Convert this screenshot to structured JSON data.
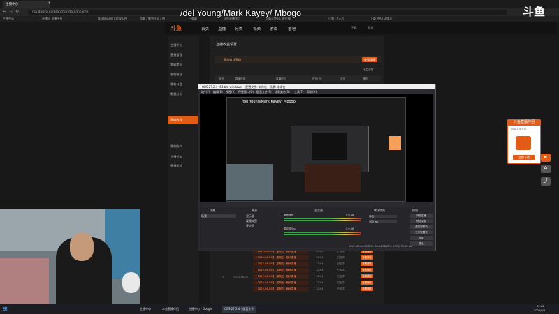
{
  "browser": {
    "tabs": [
      {
        "label": "主播中心"
      },
      {
        "label": "+"
      }
    ],
    "url": "mp.douyu.com/anchor/data/income",
    "bookmarks": [
      "主播中心",
      "直播间 直播平台",
      "Dashboard | ChatGPT",
      "你要了解到什么 | AI",
      "已收藏",
      "斗鱼直播伴侣",
      "下载斗鱼 PC 客户端",
      "已知 | 7天后",
      "下载 MAX 3 版本"
    ]
  },
  "stream_title": "/del Young/Mark Kayey/ Mbogo",
  "corner_logo": "斗鱼",
  "site": {
    "logo": "斗鱼",
    "nav": [
      "首页",
      "直播",
      "分类",
      "视频",
      "游戏",
      "鱼吧"
    ],
    "nav_right": [
      "下载",
      "登录"
    ],
    "sidebar": [
      {
        "label": "主播中心",
        "active": false
      },
      {
        "label": "直播管理",
        "active": false
      },
      {
        "label": "我的房间",
        "active": false
      },
      {
        "label": "我的粉丝",
        "active": false
      },
      {
        "label": "我的公会",
        "active": false
      },
      {
        "label": "数据分析",
        "active": false
      },
      {
        "label": "我的收益",
        "active": true
      },
      {
        "label": "我的账户",
        "active": false
      },
      {
        "label": "主播任务",
        "active": false
      },
      {
        "label": "直播学院",
        "active": false
      }
    ],
    "section_title": "直播收益设置",
    "notice": "我的收益等级",
    "notice_btn": "查看详情",
    "link_text": "收益说明",
    "table_headers": [
      "序号",
      "直播时间",
      "直播时长",
      "时长(分)",
      "状态",
      "操作"
    ],
    "rows": [
      {
        "title": "【 2022-08-05 】 星期五 · 晚间直播",
        "dur": "12:04",
        "status": "已结算",
        "btn": "查看详情"
      },
      {
        "title": "【 2022-08-05 】 星期五 · 晚间直播",
        "dur": "12:04",
        "status": "已结算",
        "btn": "查看详情"
      },
      {
        "title": "【 2022-08-05 】 星期五 · 晚间直播",
        "dur": "12:04",
        "status": "已结算",
        "btn": "查看详情"
      },
      {
        "title": "【 2022-08-05 】 星期五 · 晚间直播",
        "dur": "12:04",
        "status": "已结算",
        "btn": "查看详情"
      },
      {
        "title": "【 2022-08-05 】 星期五 · 晚间直播",
        "dur": "12:04",
        "status": "已结算",
        "btn": "查看详情"
      },
      {
        "title": "【 2022-08-05 】 星期五 · 晚间直播",
        "dur": "12:04",
        "status": "已结算",
        "btn": "查看详情"
      },
      {
        "title": "【 2022-08-05 】 星期五 · 晚间直播",
        "dur": "12:04",
        "status": "已结算",
        "btn": "查看详情"
      }
    ],
    "row_index": "1",
    "row_date": "2022-08-06"
  },
  "obs": {
    "title": "OBS 27.2.4 (64-bit, windows) - 配置文件: 未命名 - 场景: 未命名",
    "menu": [
      "文件(F)",
      "编辑(E)",
      "视图(V)",
      "停靠窗口(D)",
      "配置文件(P)",
      "场景集合(S)",
      "工具(T)",
      "帮助(H)"
    ],
    "preview_text": "/del Young/Mark Kayey/ Mbogo",
    "docks": [
      "场景",
      "来源",
      "混音器",
      "转场特效",
      "控制"
    ],
    "scene": "场景",
    "sources": [
      "显示器",
      "视频捕获",
      "麦克风"
    ],
    "mixer": [
      {
        "name": "桌面音频",
        "level": "0.0 dB"
      },
      {
        "name": "麦克风/Aux",
        "level": "0.0 dB"
      }
    ],
    "transition": "淡出",
    "transition_ms": "300 ms",
    "controls": [
      "开始直播",
      "停止录制",
      "虚拟摄像机",
      "工作室模式",
      "设置",
      "退出"
    ],
    "status": "LIVE: 00:04:38  REC: 00:04:38  CPU: 7.3%, 30.00 fps"
  },
  "promo": {
    "title": "斗鱼直播伴侣",
    "subtitle": "超级直播伴侣",
    "btn": "立即下载"
  },
  "taskbar": [
    "主播中心",
    "斗鱼直播伴侣",
    "主播中心 - Google",
    "OBS 27.2.4 - 配置文件"
  ],
  "clock": {
    "time": "23:02",
    "date": "2022/8/5"
  }
}
